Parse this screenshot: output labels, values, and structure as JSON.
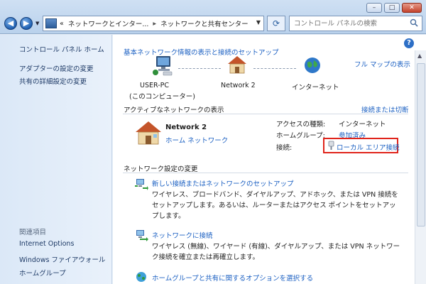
{
  "address_bar": {
    "crumbs": [
      "«",
      "ネットワークとインター...",
      "▸",
      "ネットワークと共有センター"
    ]
  },
  "search": {
    "placeholder": "コントロール パネルの検索"
  },
  "sidebar": {
    "home": "コントロール パネル ホーム",
    "adapter": "アダプターの設定の変更",
    "sharing": "共有の詳細設定の変更",
    "see_also_label": "関連項目",
    "see_also": [
      "Internet Options",
      "Windows ファイアウォール",
      "ホームグループ"
    ]
  },
  "main": {
    "header_link": "基本ネットワーク情報の表示と接続のセットアップ",
    "full_map": "フル マップの表示",
    "map": {
      "pc_name": "USER-PC",
      "pc_sub": "(このコンピューター)",
      "network": "Network  2",
      "internet": "インターネット"
    },
    "active_section": "アクティブなネットワークの表示",
    "connect_disconnect": "接続または切断",
    "active": {
      "name": "Network  2",
      "type": "ホーム ネットワーク",
      "access_label": "アクセスの種類:",
      "access_value": "インターネット",
      "homegroup_label": "ホームグループ:",
      "homegroup_value": "参加済み",
      "connection_label": "接続:",
      "connection_value": "ローカル エリア接続"
    },
    "change_section": "ネットワーク設定の変更",
    "tasks": [
      {
        "title": "新しい接続またはネットワークのセットアップ",
        "desc": "ワイヤレス、ブロードバンド、ダイヤルアップ、アドホック、または VPN 接続をセットアップします。あるいは、ルーターまたはアクセス ポイントをセットアップします。"
      },
      {
        "title": "ネットワークに接続",
        "desc": "ワイヤレス (無線)、ワイヤード (有線)、ダイヤルアップ、または VPN ネットワーク接続を確立または再確立します。"
      },
      {
        "title": "ホームグループと共有に関するオプションを選択する",
        "desc": ""
      }
    ]
  },
  "colors": {
    "link": "#1a5fc2",
    "highlight": "#e0241b"
  }
}
